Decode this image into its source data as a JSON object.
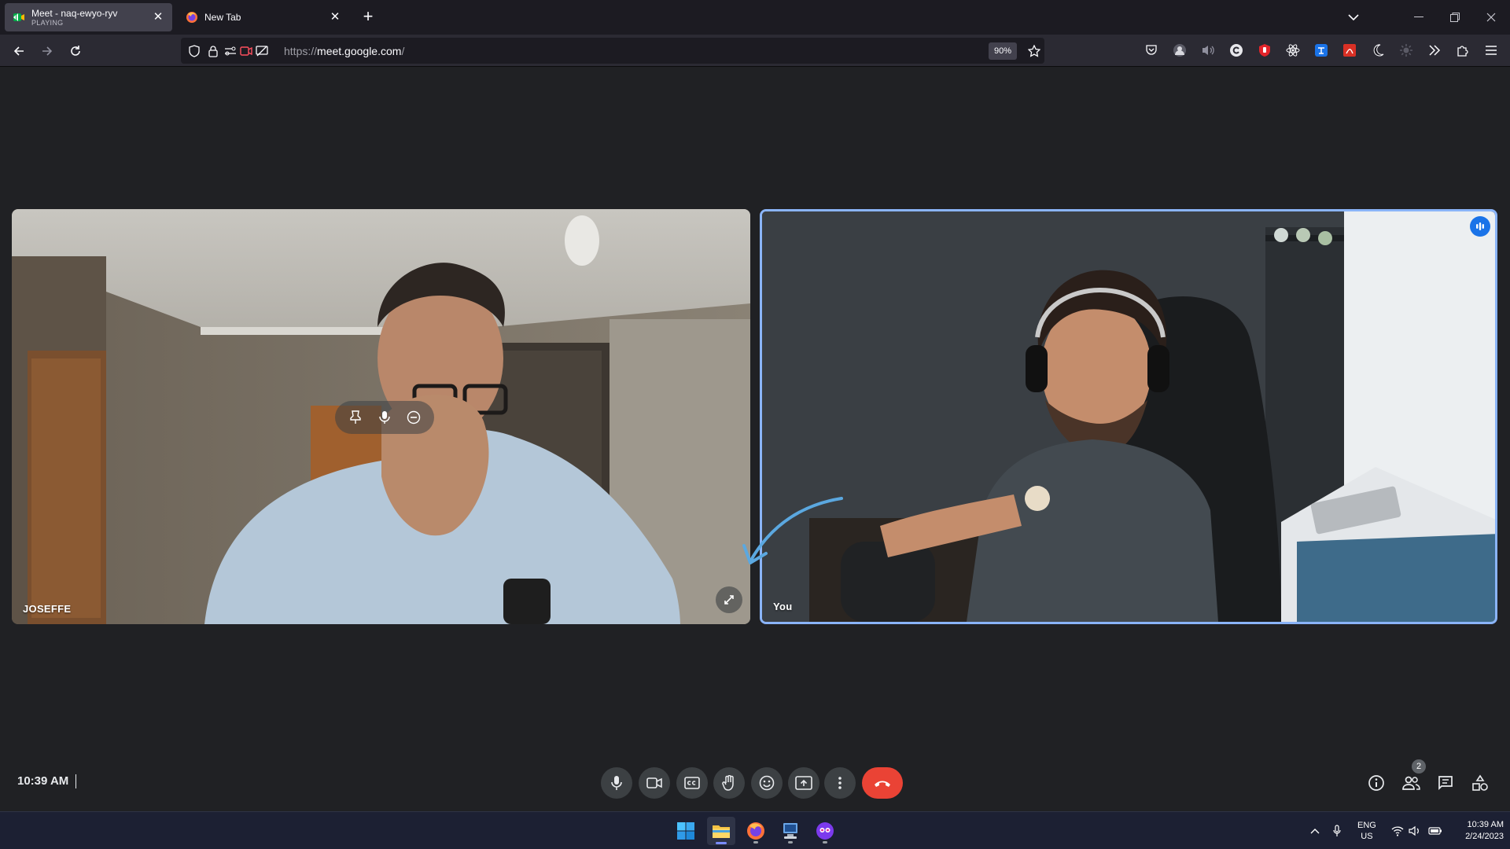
{
  "browser": {
    "tabs": [
      {
        "title": "Meet - naq-ewyo-ryv",
        "status": "PLAYING",
        "active": true
      },
      {
        "title": "New Tab",
        "active": false
      }
    ],
    "url_prefix": "https://",
    "url_host": "meet.google.com",
    "url_path": "/",
    "zoom": "90%"
  },
  "meet": {
    "participants": [
      {
        "name": "JOSEFFE",
        "position": "left"
      },
      {
        "name": "You",
        "position": "right",
        "speaking": true
      }
    ],
    "time": "10:39 AM",
    "participant_count": "2",
    "controls": [
      "microphone",
      "camera",
      "captions",
      "raise-hand",
      "reactions",
      "present",
      "more-options",
      "leave-call"
    ],
    "right_controls": [
      "meeting-details",
      "people",
      "chat",
      "activities"
    ],
    "colors": {
      "hangup": "#ea4335",
      "accent": "#8ab4f8",
      "surface": "#3c4043"
    }
  },
  "taskbar": {
    "apps": [
      "start",
      "file-explorer",
      "firefox",
      "network-app",
      "discord-like-app"
    ],
    "language": "ENG",
    "region": "US",
    "time": "10:39 AM",
    "date": "2/24/2023"
  }
}
